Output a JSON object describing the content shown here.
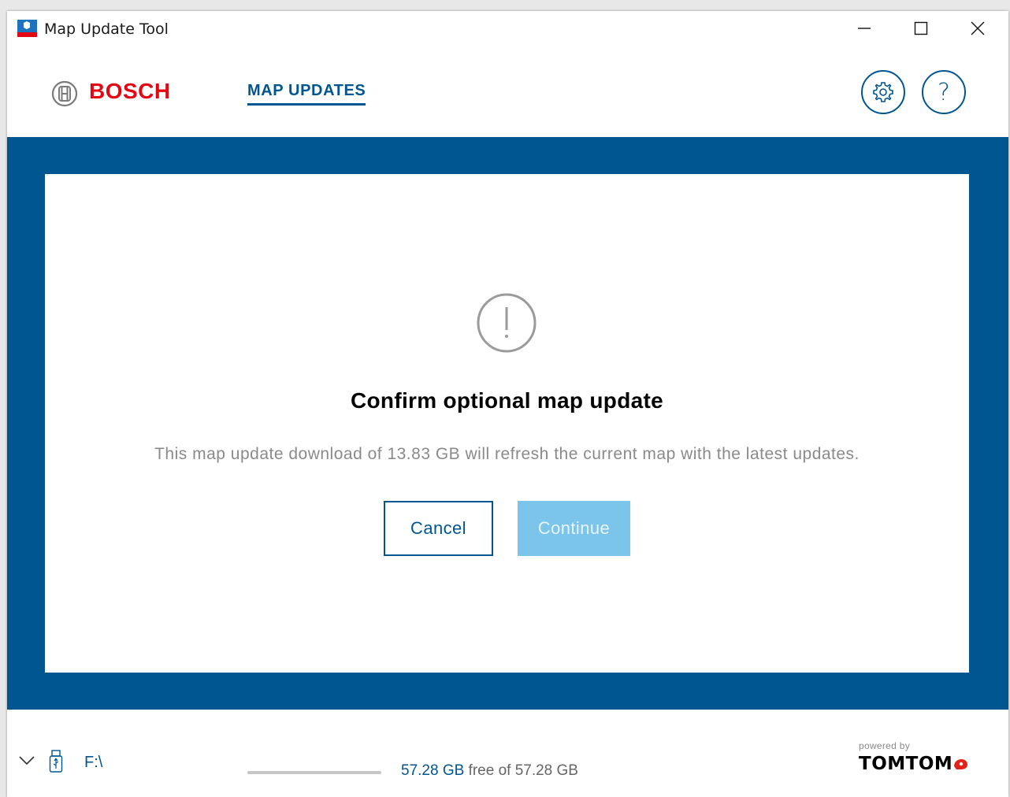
{
  "window": {
    "title": "Map Update Tool",
    "icons": {
      "app": "bosch-app-icon",
      "minimize": "minimize-icon",
      "maximize": "maximize-icon",
      "close": "close-icon"
    }
  },
  "header": {
    "brand": "BOSCH",
    "nav_tab": "MAP UPDATES",
    "settings_icon": "gear-icon",
    "help_icon": "help-icon",
    "help_glyph": "?"
  },
  "dialog": {
    "icon": "warning-icon",
    "title": "Confirm optional map update",
    "message": "This map update download of 13.83 GB will refresh the current map with the latest updates.",
    "cancel_label": "Cancel",
    "continue_label": "Continue",
    "continue_enabled": false
  },
  "footer": {
    "drive": "F:\\",
    "storage_free": "57.28 GB",
    "storage_middle": " free of ",
    "storage_total": "57.28 GB",
    "usage_fraction": 0,
    "powered_by": "powered by",
    "partner": "TOMTOM"
  },
  "colors": {
    "primary": "#005691",
    "brand_red": "#e30613",
    "continue_disabled": "#7bc4ea",
    "muted_text": "#8a8a8a"
  }
}
